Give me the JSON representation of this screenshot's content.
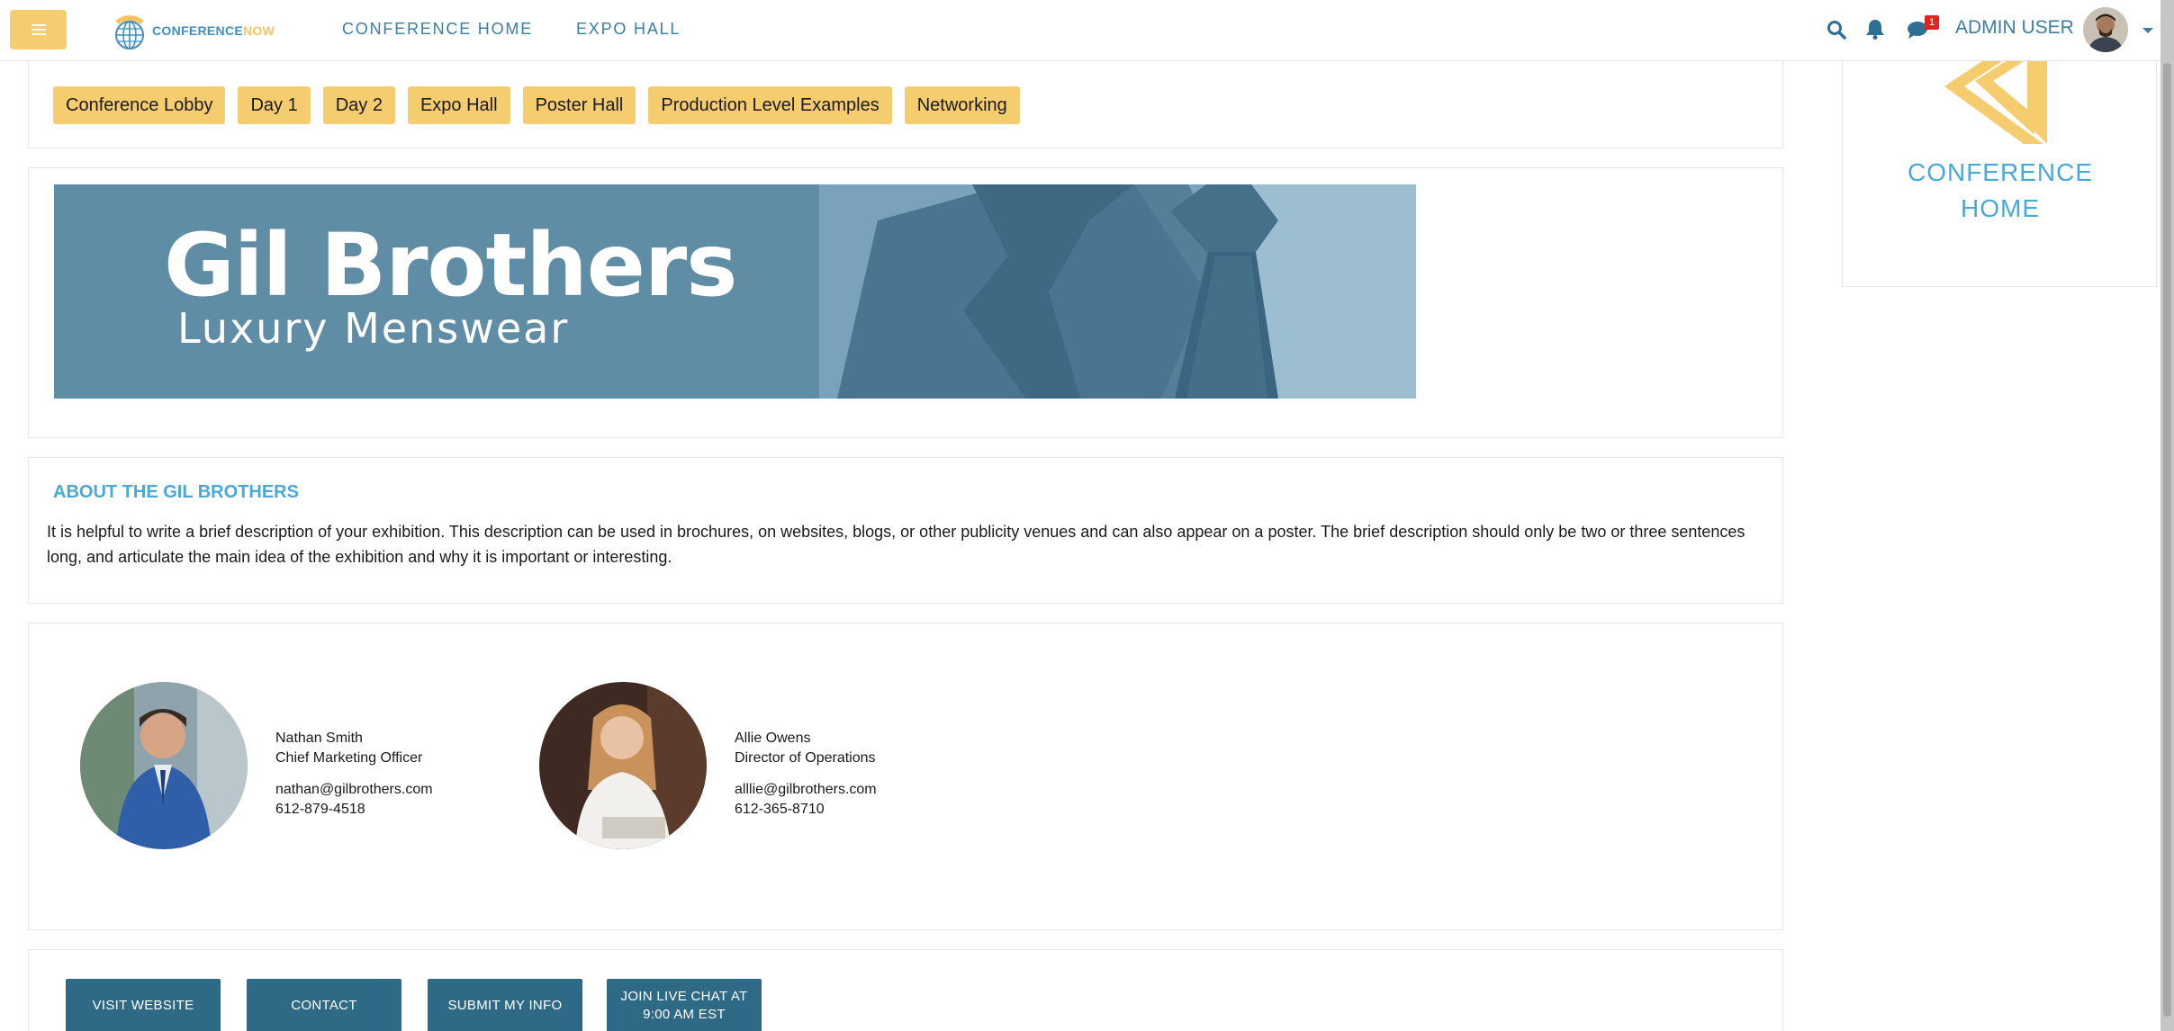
{
  "navbar": {
    "logo_text_a": "CONFERENCE",
    "logo_text_b": "NOW",
    "links": [
      {
        "label": "CONFERENCE HOME"
      },
      {
        "label": "EXPO HALL"
      }
    ],
    "chat_badge_count": "1",
    "user_label": "ADMIN USER"
  },
  "tabs": [
    {
      "label": "Conference Lobby"
    },
    {
      "label": "Day 1"
    },
    {
      "label": "Day 2"
    },
    {
      "label": "Expo Hall"
    },
    {
      "label": "Poster Hall"
    },
    {
      "label": "Production Level Examples"
    },
    {
      "label": "Networking"
    }
  ],
  "banner": {
    "title": "Gil Brothers",
    "subtitle": "Luxury Menswear"
  },
  "about": {
    "title": "ABOUT THE GIL BROTHERS",
    "body": "It is helpful to write a brief description of your exhibition. This description can be used in brochures, on websites, blogs, or other publicity venues and can also appear on a poster. The brief description should only be two or three sentences long, and articulate the main idea of the exhibition and why it is important or interesting."
  },
  "staff": [
    {
      "name": "Nathan Smith",
      "role": "Chief Marketing Officer",
      "email": "nathan@gilbrothers.com",
      "phone": "612-879-4518"
    },
    {
      "name": "Allie Owens",
      "role": "Director of Operations",
      "email": "alllie@gilbrothers.com",
      "phone": "612-365-8710"
    }
  ],
  "actions": [
    {
      "label": "VISIT WEBSITE"
    },
    {
      "label": "CONTACT"
    },
    {
      "label": "SUBMIT MY INFO"
    },
    {
      "label_line1": "JOIN LIVE CHAT AT",
      "label_line2": "9:00 AM EST"
    }
  ],
  "sidebar": {
    "title_line1": "CONFERENCE",
    "title_line2": "HOME"
  },
  "colors": {
    "accent_yellow": "#f5cc6e",
    "link_blue": "#3b7ea1",
    "heading_blue": "#4aa8d8",
    "button_teal": "#2e6a86",
    "badge_red": "#e02424"
  },
  "icons": [
    "menu-icon",
    "globe-phone-logo-icon",
    "search-icon",
    "bell-icon",
    "chat-icon",
    "chevron-down-icon",
    "conference-home-chevron-icon"
  ]
}
